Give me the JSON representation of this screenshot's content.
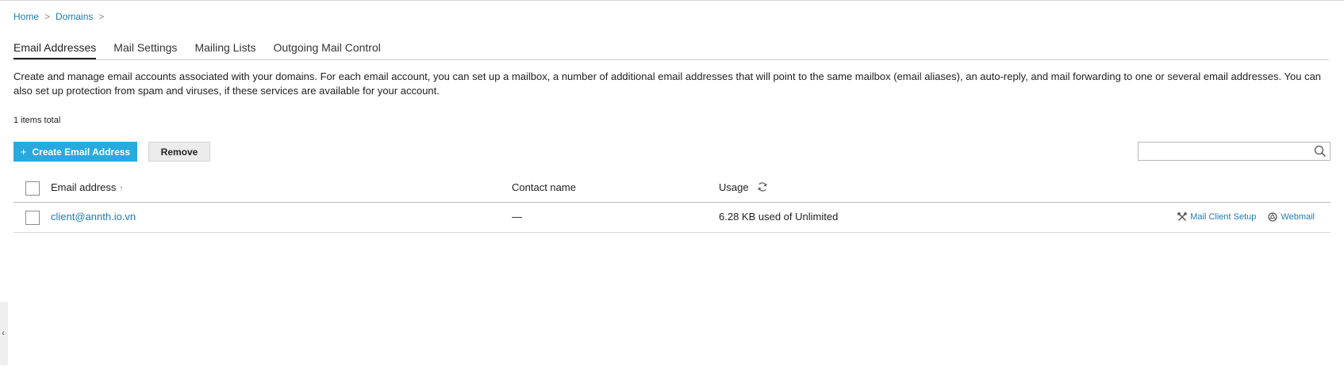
{
  "breadcrumb": {
    "items": [
      "Home",
      "Domains"
    ],
    "separator": ">"
  },
  "tabs": [
    {
      "label": "Email Addresses",
      "active": true
    },
    {
      "label": "Mail Settings",
      "active": false
    },
    {
      "label": "Mailing Lists",
      "active": false
    },
    {
      "label": "Outgoing Mail Control",
      "active": false
    }
  ],
  "description": "Create and manage email accounts associated with your domains. For each email account, you can set up a mailbox, a number of additional email addresses that will point to the same mailbox (email aliases), an auto-reply, and mail forwarding to one or several email addresses. You can also set up protection from spam and viruses, if these services are available for your account.",
  "items_total": "1 items total",
  "toolbar": {
    "create_label": "Create Email Address",
    "create_icon": "+",
    "remove_label": "Remove",
    "search_placeholder": ""
  },
  "table": {
    "columns": {
      "email": "Email address",
      "email_sort_icon": "↑",
      "contact": "Contact name",
      "usage": "Usage"
    },
    "rows": [
      {
        "email": "client@annth.io.vn",
        "contact": "—",
        "usage": "6.28 KB used of Unlimited",
        "action_setup": "Mail Client Setup",
        "action_webmail": "Webmail"
      }
    ]
  },
  "side_handle_icon": "‹",
  "colors": {
    "link": "#1a7db5",
    "primary_button": "#28aade"
  }
}
